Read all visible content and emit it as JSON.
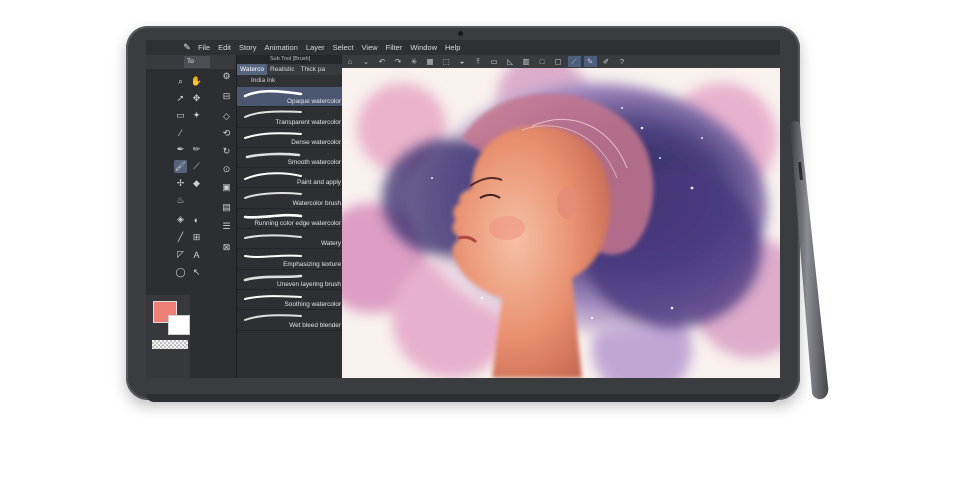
{
  "menu": {
    "items": [
      "File",
      "Edit",
      "Story",
      "Animation",
      "Layer",
      "Select",
      "View",
      "Filter",
      "Window",
      "Help"
    ]
  },
  "tool_panel": {
    "tab_label": "To"
  },
  "sub_tool": {
    "title": "Sub Tool [Brush]",
    "tabs": [
      "Waterco",
      "Realistic",
      "Thick pa"
    ],
    "group_label": "India ink",
    "brushes": [
      "Opaque watercolor",
      "Transparent watercolor",
      "Dense watercolor",
      "Smooth watercolor",
      "Paint and apply",
      "Watercolor brush",
      "Running color edge watercolor",
      "Watery",
      "Emphasizing texture",
      "Uneven layering brush",
      "Soothing watercolor",
      "Wet bleed blender"
    ],
    "selected_index": 0
  },
  "colors": {
    "main": "#ee7f74",
    "sub": "#ffffff",
    "accent": "#56637d"
  },
  "icons": {
    "canvas_toolbar": [
      "rotate-icon",
      "chevron-down-icon",
      "undo-icon",
      "redo-icon",
      "loading-icon",
      "clear-icon",
      "transform-icon",
      "fill-icon",
      "move-layer-icon",
      "crop-icon",
      "ruler-icon",
      "grid-icon",
      "pen-stroke-icon",
      "pen-smooth-icon",
      "pen-pressure-icon",
      "help-icon"
    ]
  }
}
